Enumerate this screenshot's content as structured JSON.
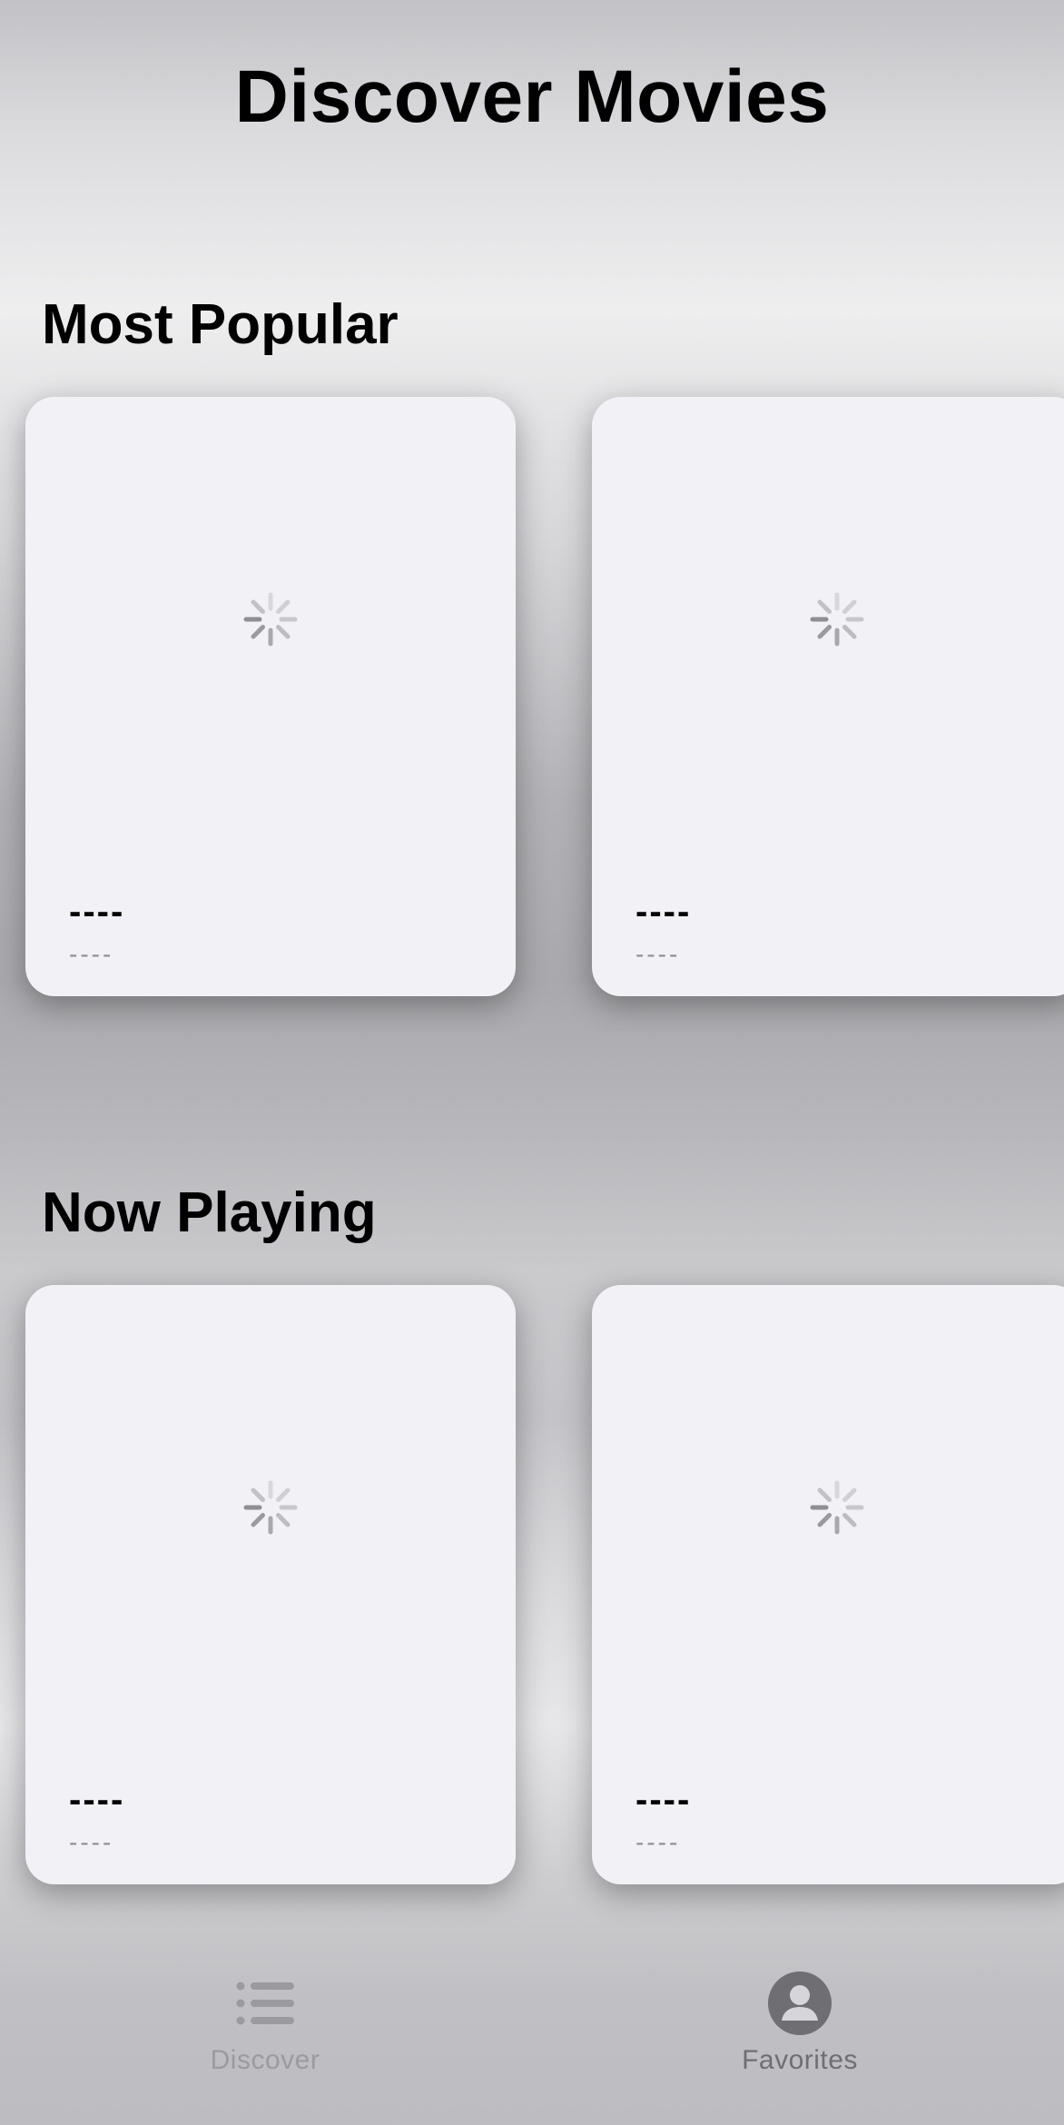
{
  "header": {
    "title": "Discover Movies"
  },
  "sections": [
    {
      "title": "Most Popular",
      "cards": [
        {
          "title": "----",
          "subtitle": "----",
          "icon": "loading-spinner-icon"
        },
        {
          "title": "----",
          "subtitle": "----",
          "icon": "loading-spinner-icon"
        }
      ]
    },
    {
      "title": "Now Playing",
      "cards": [
        {
          "title": "----",
          "subtitle": "----",
          "icon": "loading-spinner-icon"
        },
        {
          "title": "----",
          "subtitle": "----",
          "icon": "loading-spinner-icon"
        }
      ]
    }
  ],
  "tabbar": {
    "tabs": [
      {
        "label": "Discover",
        "icon": "list-icon"
      },
      {
        "label": "Favorites",
        "icon": "person-icon"
      }
    ]
  },
  "colors": {
    "card_background": "#f2f2f6",
    "secondary_text": "#8e8e93",
    "tab_icon_active": "#6e6e73",
    "tab_icon_inactive": "#9a9a9f"
  }
}
